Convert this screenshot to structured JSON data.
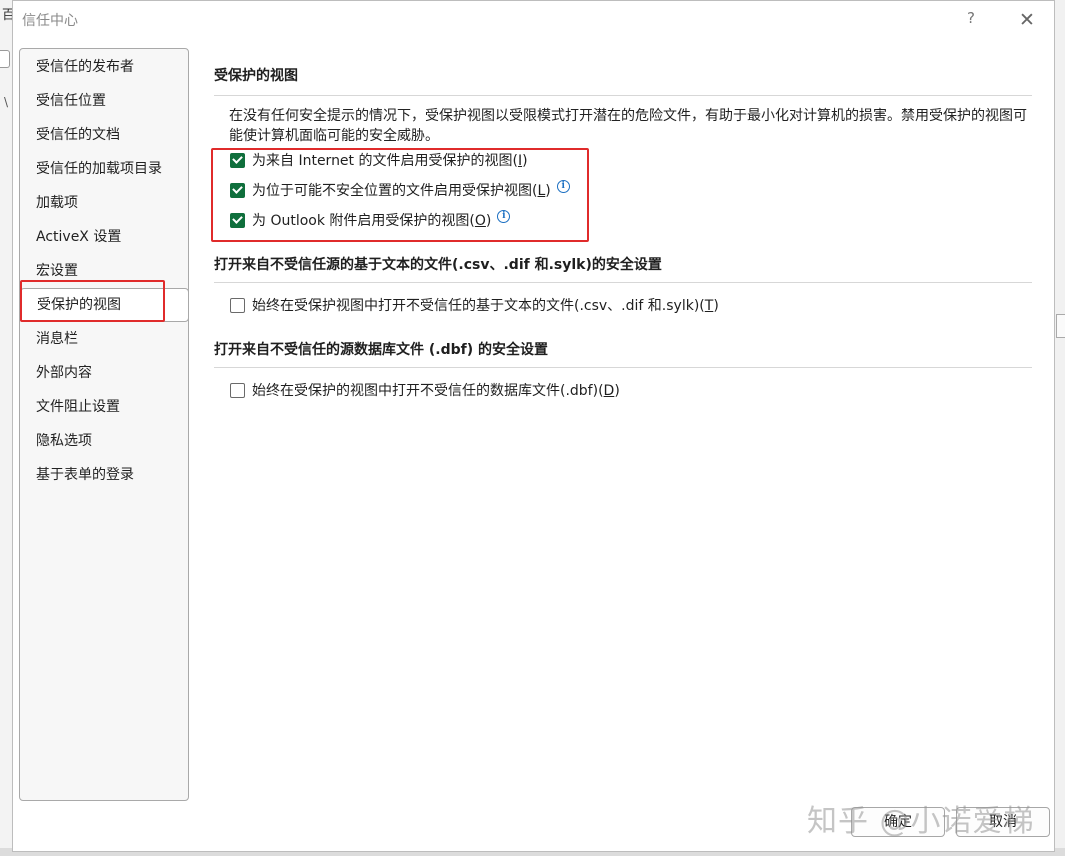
{
  "dialog": {
    "title": "信任中心",
    "help": "?",
    "close": "✕"
  },
  "background": {
    "left_char": "百",
    "left_tick": "\\"
  },
  "sidebar": {
    "items": [
      {
        "label": "受信任的发布者"
      },
      {
        "label": "受信任位置"
      },
      {
        "label": "受信任的文档"
      },
      {
        "label": "受信任的加载项目录"
      },
      {
        "label": "加载项"
      },
      {
        "label": "ActiveX 设置"
      },
      {
        "label": "宏设置"
      },
      {
        "label": "受保护的视图",
        "selected": true
      },
      {
        "label": "消息栏"
      },
      {
        "label": "外部内容"
      },
      {
        "label": "文件阻止设置"
      },
      {
        "label": "隐私选项"
      },
      {
        "label": "基于表单的登录"
      }
    ]
  },
  "protected_view": {
    "title": "受保护的视图",
    "description": "在没有任何安全提示的情况下，受保护视图以受限模式打开潜在的危险文件，有助于最小化对计算机的损害。禁用受保护的视图可能使计算机面临可能的安全威胁。",
    "options": [
      {
        "label": "为来自 Internet 的文件启用受保护的视图(",
        "key": "I",
        "end": ")",
        "checked": true
      },
      {
        "label": "为位于可能不安全位置的文件启用受保护视图(",
        "key": "L",
        "end": ")",
        "checked": true
      },
      {
        "label": "为 Outlook 附件启用受保护的视图(",
        "key": "O",
        "end": ")",
        "checked": true
      }
    ]
  },
  "text_files": {
    "title": "打开来自不受信任源的基于文本的文件(.csv、.dif 和.sylk)的安全设置",
    "option": {
      "label": "始终在受保护视图中打开不受信任的基于文本的文件(.csv、.dif 和.sylk)(",
      "key": "T",
      "end": ")",
      "checked": false
    }
  },
  "dbf_files": {
    "title": "打开来自不受信任的源数据库文件 (.dbf) 的安全设置",
    "option": {
      "label": "始终在受保护的视图中打开不受信任的数据库文件(.dbf)(",
      "key": "D",
      "end": ")",
      "checked": false
    }
  },
  "buttons": {
    "ok": "确定",
    "cancel": "取消"
  },
  "watermark": "知乎 @小诺爱梯",
  "colors": {
    "checkbox_checked": "#0f6f3c",
    "highlight_box": "#e02b2b",
    "info_icon": "#1b6fc2"
  }
}
